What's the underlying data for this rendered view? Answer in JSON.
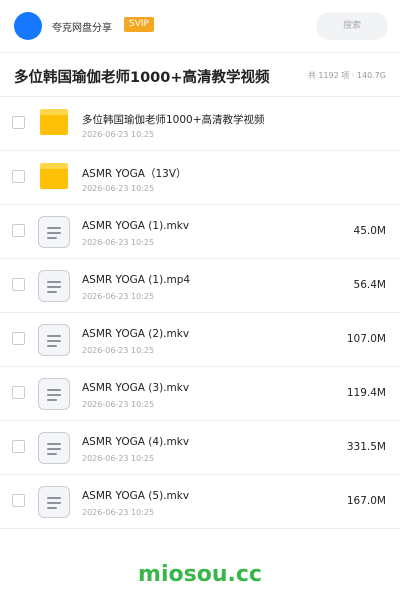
{
  "topbar": {
    "username": "夸克网盘分享",
    "badge": "SVIP",
    "search_label": "搜索"
  },
  "folder": {
    "title": "多位韩国瑜伽老师1000+高清教学视频",
    "meta": "共 1192 项 · 140.7G"
  },
  "items": [
    {
      "type": "folder",
      "name": "多位韩国瑜伽老师1000+高清教学视频",
      "date": "2026-06-23 10:25",
      "size": ""
    },
    {
      "type": "folder",
      "name": "ASMR YOGA（13V）",
      "date": "2026-06-23 10:25",
      "size": ""
    },
    {
      "type": "file",
      "name": "ASMR YOGA (1).mkv",
      "date": "2026-06-23 10:25",
      "size": "45.0M"
    },
    {
      "type": "file",
      "name": "ASMR YOGA (1).mp4",
      "date": "2026-06-23 10:25",
      "size": "56.4M"
    },
    {
      "type": "file",
      "name": "ASMR YOGA (2).mkv",
      "date": "2026-06-23 10:25",
      "size": "107.0M"
    },
    {
      "type": "file",
      "name": "ASMR YOGA (3).mkv",
      "date": "2026-06-23 10:25",
      "size": "119.4M"
    },
    {
      "type": "file",
      "name": "ASMR YOGA (4).mkv",
      "date": "2026-06-23 10:25",
      "size": "331.5M"
    },
    {
      "type": "file",
      "name": "ASMR YOGA (5).mkv",
      "date": "2026-06-23 10:25",
      "size": "167.0M"
    }
  ],
  "icons": {
    "folder": "folder-icon",
    "file": "document-icon"
  },
  "colors": {
    "accent": "#1677ff",
    "svip": "#f5a623",
    "folder": "#ffc107",
    "watermark": "#3ab54a"
  },
  "watermark": "miosou.cc"
}
